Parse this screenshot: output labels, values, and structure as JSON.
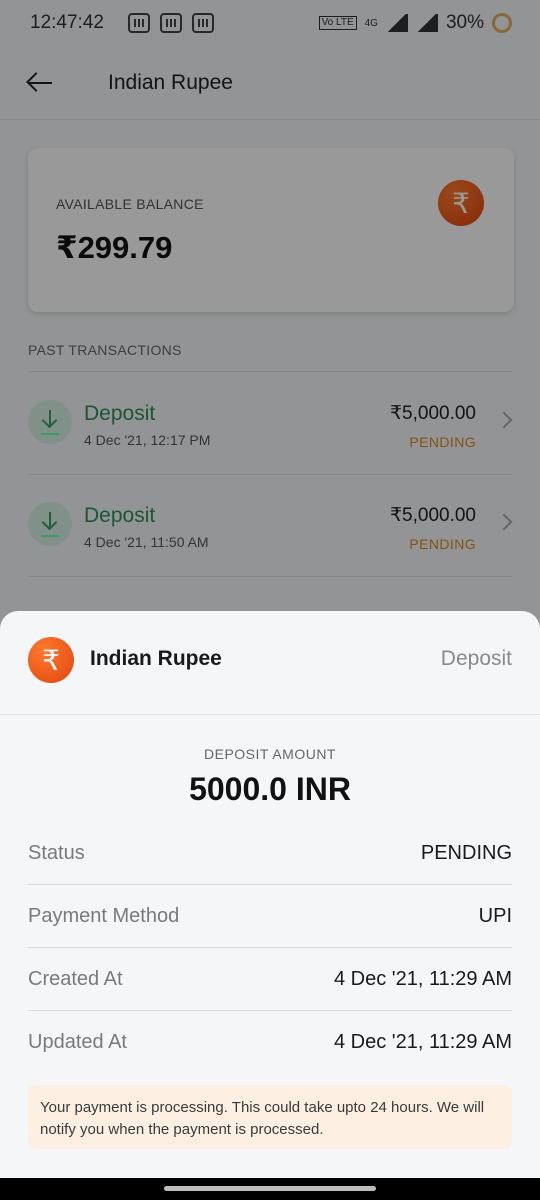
{
  "status_bar": {
    "time": "12:47:42",
    "volte": "Vo LTE",
    "network": "4G",
    "battery": "30%"
  },
  "header": {
    "title": "Indian Rupee"
  },
  "balance": {
    "label": "AVAILABLE BALANCE",
    "value": "₹299.79",
    "currency_symbol": "₹"
  },
  "transactions": {
    "section_label": "PAST TRANSACTIONS",
    "items": [
      {
        "type": "Deposit",
        "date": "4 Dec '21, 12:17 PM",
        "amount": "₹5,000.00",
        "status": "PENDING"
      },
      {
        "type": "Deposit",
        "date": "4 Dec '21, 11:50 AM",
        "amount": "₹5,000.00",
        "status": "PENDING"
      }
    ]
  },
  "sheet": {
    "currency_symbol": "₹",
    "title": "Indian Rupee",
    "type": "Deposit",
    "amount_label": "DEPOSIT AMOUNT",
    "amount_value": "5000.0 INR",
    "details": [
      {
        "key": "Status",
        "value": "PENDING"
      },
      {
        "key": "Payment Method",
        "value": "UPI"
      },
      {
        "key": "Created At",
        "value": "4 Dec '21, 11:29 AM"
      },
      {
        "key": "Updated At",
        "value": "4 Dec '21, 11:29 AM"
      }
    ],
    "notice": "Your payment is processing. This could take upto 24 hours. We will notify you when the payment is processed."
  },
  "colors": {
    "accent_orange": "#e0440e",
    "deposit_green": "#2f8f5c",
    "pending_amber": "#d98c1f",
    "notice_bg": "#fdf0e2"
  }
}
